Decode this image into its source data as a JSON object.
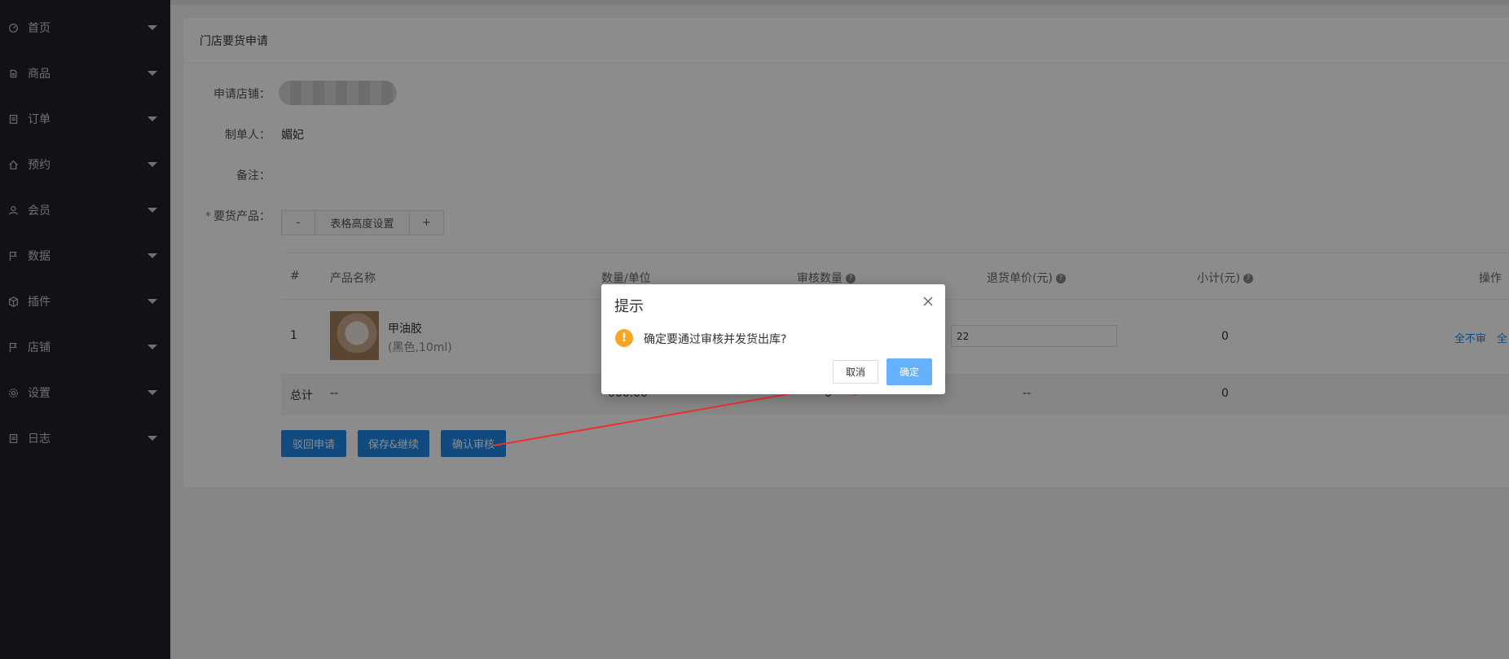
{
  "sidebar": {
    "items": [
      {
        "label": "首页",
        "icon": "dashboard-icon"
      },
      {
        "label": "商品",
        "icon": "goods-icon"
      },
      {
        "label": "订单",
        "icon": "order-icon"
      },
      {
        "label": "预约",
        "icon": "home-icon"
      },
      {
        "label": "会员",
        "icon": "user-icon"
      },
      {
        "label": "数据",
        "icon": "flag-icon"
      },
      {
        "label": "插件",
        "icon": "cube-icon"
      },
      {
        "label": "店铺",
        "icon": "flag-icon"
      },
      {
        "label": "设置",
        "icon": "gear-icon"
      },
      {
        "label": "日志",
        "icon": "log-icon"
      }
    ]
  },
  "card": {
    "title": "门店要货申请",
    "store_label": "申请店铺：",
    "maker_label": "制单人：",
    "maker_value": "媚妃",
    "remark_label": "备注：",
    "products_label": "要货产品："
  },
  "height_controls": {
    "minus": "-",
    "label": "表格高度设置",
    "plus": "+"
  },
  "table": {
    "headers": {
      "index": "#",
      "name": "产品名称",
      "qty_unit": "数量/单位",
      "audit_qty": "审核数量",
      "return_price": "退货单价(元)",
      "subtotal": "小计(元)",
      "action": "操作"
    },
    "row": {
      "index": "1",
      "product_name": "甲油胶",
      "product_spec": "(黑色,10ml)",
      "price_value": "22",
      "subtotal": "0",
      "action_none": "全不审",
      "action_all": "全"
    },
    "total": {
      "label": "总计",
      "name": "--",
      "qty": "000.00",
      "audit_qty": "0",
      "return_price": "--",
      "subtotal": "0"
    }
  },
  "actions": {
    "reject": "驳回申请",
    "save_continue": "保存&继续",
    "confirm_audit": "确认审核"
  },
  "dialog": {
    "title": "提示",
    "message": "确定要通过审核并发货出库?",
    "cancel": "取消",
    "ok": "确定",
    "warn_glyph": "!"
  },
  "colors": {
    "sidebar_bg": "#20222a",
    "primary": "#1e88e5",
    "dialog_ok": "#66b1ff",
    "warning": "#f5a623",
    "annotation_arrow": "#e8322e"
  }
}
